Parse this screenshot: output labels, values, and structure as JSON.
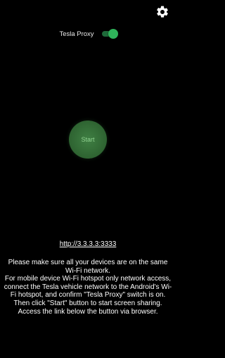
{
  "header": {
    "settings_icon": "gear-icon"
  },
  "proxy": {
    "label": "Tesla Proxy",
    "enabled": true
  },
  "start_button": {
    "label": "Start"
  },
  "link": {
    "url": "http://3.3.3.3:3333"
  },
  "instructions": {
    "line1": "Please make sure all your devices are on the same Wi-Fi network.",
    "line2": "For mobile device Wi-Fi hotspot only network access, connect the Tesla vehicle network to the Android's Wi-Fi hotspot, and confirm \"Tesla Proxy\" switch is on.",
    "line3": "Then click \"Start\" button to start screen sharing. Access the link below the button via browser."
  },
  "colors": {
    "background": "#000000",
    "switch_track": "#1e6b3a",
    "switch_thumb": "#2fb35a",
    "start_fill": "#2e6331",
    "start_text": "#8fd08f"
  }
}
